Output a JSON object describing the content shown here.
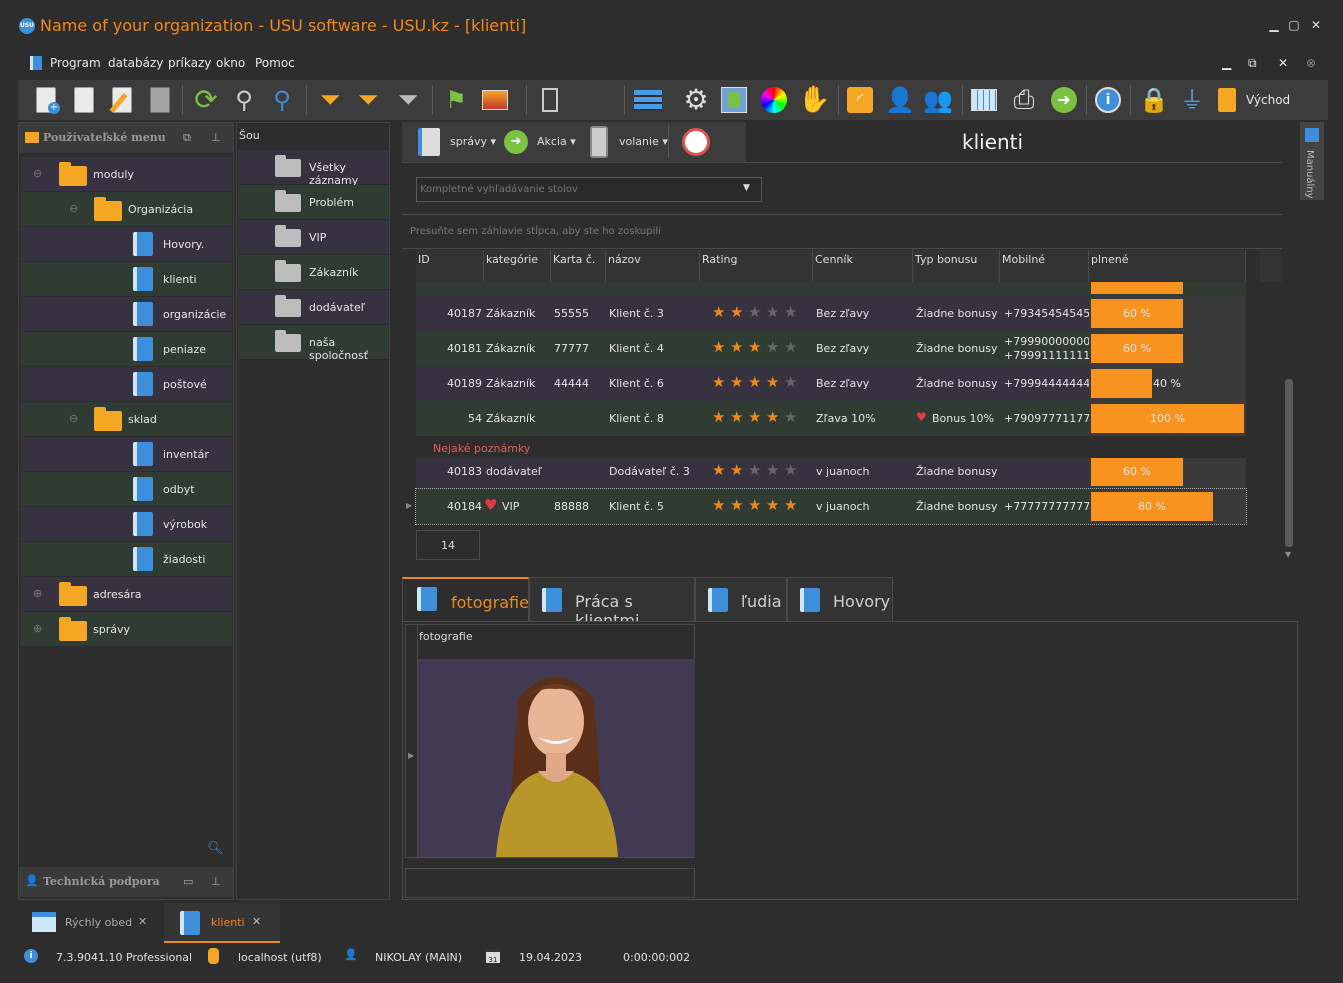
{
  "window": {
    "title": "Name of your organization - USU software - USU.kz - [klienti]",
    "logo": "USU"
  },
  "menu": [
    "Program",
    "databázy",
    "príkazy",
    "okno",
    "Pomoc"
  ],
  "toolbar": {
    "exit_label": "Východ"
  },
  "left_panel": {
    "title": "Používateľské menu",
    "support": "Technická podpora",
    "tree": [
      {
        "label": "moduly"
      },
      {
        "label": "Organizácia"
      },
      {
        "label": "Hovory."
      },
      {
        "label": "klienti"
      },
      {
        "label": "organizácie"
      },
      {
        "label": "peniaze"
      },
      {
        "label": "poštové"
      },
      {
        "label": "sklad"
      },
      {
        "label": "inventár"
      },
      {
        "label": "odbyt"
      },
      {
        "label": "výrobok"
      },
      {
        "label": "žiadosti"
      },
      {
        "label": "adresára"
      },
      {
        "label": "správy"
      }
    ]
  },
  "show_panel": {
    "title": "Šou",
    "items": [
      "Všetky záznamy",
      "Problém",
      "VIP",
      "Zákazník",
      "dodávateľ",
      "naša spoločnosť"
    ]
  },
  "secondary_toolbar": {
    "reports": "správy",
    "action": "Akcia",
    "call": "volanie"
  },
  "page": {
    "title": "klienti",
    "side_tab": "Manuálny"
  },
  "search": {
    "placeholder": "Kompletné vyhľadávanie stolov"
  },
  "group_hint": "Presuňte sem záhlavie stĺpca, aby ste ho zoskupili",
  "grid": {
    "columns": [
      "ID",
      "kategórie",
      "Karta č.",
      "názov",
      "Rating",
      "Cenník",
      "Typ bonusu",
      "Mobilné",
      "plnené"
    ],
    "rows": [
      {
        "id": "40187",
        "category": "Zákazník",
        "card": "55555",
        "name": "Klient č. 3",
        "rating": 2,
        "price": "Bez zľavy",
        "bonus": "Žiadne bonusy",
        "mobile": "+79345454545",
        "mobile2": "",
        "pct": 60,
        "pct_label": "60 %"
      },
      {
        "id": "40181",
        "category": "Zákazník",
        "card": "77777",
        "name": "Klient č. 4",
        "rating": 3,
        "price": "Bez zľavy",
        "bonus": "Žiadne bonusy",
        "mobile": "+79990000000,",
        "mobile2": "+79991111111",
        "pct": 60,
        "pct_label": "60 %"
      },
      {
        "id": "40189",
        "category": "Zákazník",
        "card": "44444",
        "name": "Klient č. 6",
        "rating": 4,
        "price": "Bez zľavy",
        "bonus": "Žiadne bonusy",
        "mobile": "+79994444444",
        "mobile2": "",
        "pct": 40,
        "pct_label": "40 %"
      },
      {
        "id": "54",
        "category": "Zákazník",
        "card": "",
        "name": "Klient č. 8",
        "rating": 4,
        "price": "Zľava 10%",
        "bonus": "Bonus 10%",
        "mobile": "+79097771177",
        "mobile2": "",
        "pct": 100,
        "pct_label": "100 %"
      },
      {
        "id": "40183",
        "category": "dodávateľ",
        "card": "",
        "name": "Dodávateľ č. 3",
        "rating": 2,
        "price": "v juanoch",
        "bonus": "Žiadne bonusy",
        "mobile": "",
        "mobile2": "",
        "pct": 60,
        "pct_label": "60 %"
      },
      {
        "id": "40184",
        "category": "VIP",
        "card": "88888",
        "name": "Klient č. 5",
        "rating": 5,
        "price": "v juanoch",
        "bonus": "Žiadne bonusy",
        "mobile": "+77777777777",
        "mobile2": "",
        "pct": 80,
        "pct_label": "80 %"
      }
    ],
    "note": "Nejaké poznámky",
    "count": "14"
  },
  "tabs": [
    "fotografie",
    "Práca s klientmi",
    "ľudia",
    "Hovory"
  ],
  "detail": {
    "photo_header": "fotografie"
  },
  "bottom_tabs": [
    {
      "label": "Rýchly obed"
    },
    {
      "label": "klienti"
    }
  ],
  "status": {
    "version": "7.3.9041.10 Professional",
    "db": "localhost (utf8)",
    "user": "NIKOLAY (MAIN)",
    "date": "19.04.2023",
    "time": "0:00:00:002"
  },
  "colors": {
    "accent": "#f0881a",
    "bar": "#f7931e",
    "row_a": "#363240",
    "row_b": "#2f3b33"
  }
}
